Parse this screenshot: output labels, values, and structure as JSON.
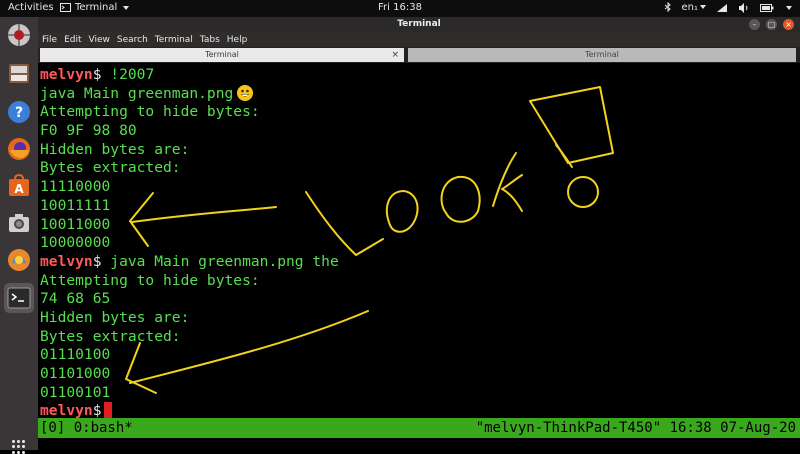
{
  "topbar": {
    "activities": "Activities",
    "app_name": "Terminal",
    "clock": "Fri 16:38",
    "keyboard_layout": "en₁"
  },
  "window": {
    "title": "Terminal"
  },
  "menu": [
    "File",
    "Edit",
    "View",
    "Search",
    "Terminal",
    "Tabs",
    "Help"
  ],
  "tabs": [
    {
      "label": "Terminal",
      "active": true
    },
    {
      "label": "Terminal",
      "active": false
    }
  ],
  "terminal": {
    "lines": [
      {
        "prompt": "melvyn",
        "sym": "$",
        "cmd": " !2007"
      },
      {
        "text": "java Main greenman.png"
      },
      {
        "text": "Attempting to hide bytes:"
      },
      {
        "text": "F0 9F 98 80"
      },
      {
        "text": "Hidden bytes are:"
      },
      {
        "text": "Bytes extracted:"
      },
      {
        "text": "11110000"
      },
      {
        "text": "10011111"
      },
      {
        "text": "10011000"
      },
      {
        "text": "10000000"
      },
      {
        "prompt": "melvyn",
        "sym": "$",
        "cmd": " java Main greenman.png the"
      },
      {
        "text": "Attempting to hide bytes:"
      },
      {
        "text": "74 68 65"
      },
      {
        "text": "Hidden bytes are:"
      },
      {
        "text": "Bytes extracted:"
      },
      {
        "text": "01110100"
      },
      {
        "text": "01101000"
      },
      {
        "text": "01100101"
      },
      {
        "prompt": "melvyn",
        "sym": "$",
        "cmd": ""
      }
    ]
  },
  "status": {
    "left": "[0] 0:bash*",
    "right": "\"melvyn-ThinkPad-T450\" 16:38 07-Aug-20"
  },
  "colors": {
    "terminal_text": "#56e04e",
    "prompt": "#ff5a5a",
    "status_bar": "#3aa81c",
    "annotation": "#f2d21b"
  }
}
